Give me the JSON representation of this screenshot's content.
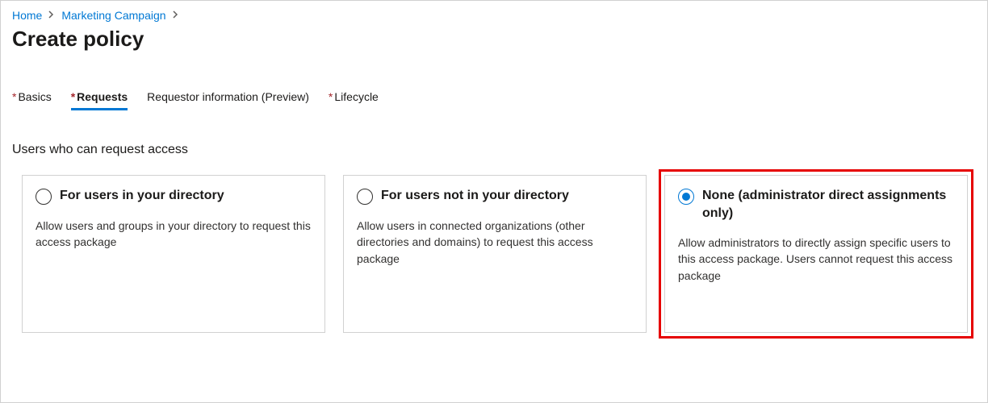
{
  "breadcrumb": {
    "home": "Home",
    "campaign": "Marketing Campaign"
  },
  "page_title": "Create policy",
  "tabs": {
    "basics": "Basics",
    "requests": "Requests",
    "requestor_info": "Requestor information (Preview)",
    "lifecycle": "Lifecycle"
  },
  "section_heading": "Users who can request access",
  "cards": {
    "in_directory": {
      "title": "For users in your directory",
      "desc": "Allow users and groups in your directory to request this access package"
    },
    "not_in_directory": {
      "title": "For users not in your directory",
      "desc": "Allow users in connected organizations (other directories and domains) to request this access package"
    },
    "none": {
      "title": "None (administrator direct assignments only)",
      "desc": "Allow administrators to directly assign specific users to this access package. Users cannot request this access package"
    }
  }
}
